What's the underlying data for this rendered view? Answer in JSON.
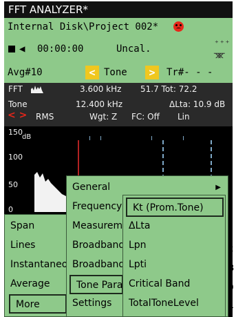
{
  "app": {
    "title": "FFT ANALYZER*"
  },
  "status": {
    "path": "Internal Disk\\Project 002*",
    "time": "00:00:00",
    "calibration": "Uncal.",
    "avg": "Avg#10",
    "mode": "Tone",
    "track": "Tr#- - -"
  },
  "readouts": {
    "fft": "FFT",
    "fft_freq": "3.600 kHz",
    "fft_level": "51.7 Tot: 72.2",
    "tone": "Tone",
    "tone_freq": "12.400 kHz",
    "delta_lta": "ΔLta: 10.9 dB",
    "rms": "RMS",
    "weighting": "Wgt: Z",
    "fc": "FC: Off",
    "scale": "Lin"
  },
  "plot": {
    "y_labels": [
      "150",
      "100",
      "50",
      "0"
    ],
    "y_unit": "dB"
  },
  "menus": {
    "main": [
      "Span",
      "Lines",
      "Instantaneous",
      "Average",
      "More"
    ],
    "more": [
      "General",
      "Frequency",
      "Measurement",
      "Broadband",
      "Broadband",
      "Tone Parameters",
      "Settings"
    ],
    "tone_parameters": [
      "Kt (Prom.Tone)",
      "ΔLta",
      "Lpn",
      "Lpti",
      "Critical Band",
      "TotalToneLevel"
    ]
  },
  "edge_text": [
    "k",
    "B",
    "0",
    "4"
  ],
  "icons": {
    "arrow_left": "<",
    "arrow_right": ">",
    "submenu": "▶",
    "speaker": "◀"
  },
  "colors": {
    "panel_green": "#8ec98a",
    "accent_yellow": "#f0c71f",
    "alert_red": "#e8261a",
    "cursor_red": "#b22222"
  }
}
